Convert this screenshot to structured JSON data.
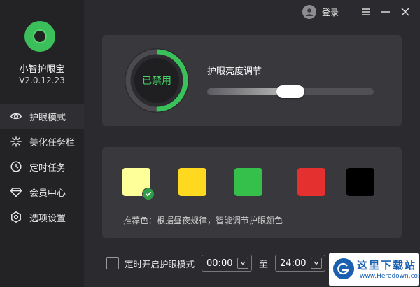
{
  "app": {
    "name": "小智护眼宝",
    "version": "V2.0.12.23"
  },
  "topbar": {
    "login_label": "登录"
  },
  "sidebar": {
    "items": [
      {
        "label": "护眼模式",
        "icon": "eye-icon",
        "active": true
      },
      {
        "label": "美化任务栏",
        "icon": "sparkle-icon",
        "active": false
      },
      {
        "label": "定时任务",
        "icon": "clock-icon",
        "active": false
      },
      {
        "label": "会员中心",
        "icon": "diamond-icon",
        "active": false
      },
      {
        "label": "选项设置",
        "icon": "settings-icon",
        "active": false
      }
    ]
  },
  "eye_mode": {
    "status": "已禁用",
    "status_ring_progress": 0.5,
    "brightness_label": "护眼亮度调节",
    "brightness_value": 0.5
  },
  "colors": {
    "swatches": [
      {
        "color": "#ffff99",
        "selected": true
      },
      {
        "color": "#ffd91f",
        "selected": false
      },
      {
        "color": "#34c04b",
        "selected": false
      },
      {
        "color": "#e53030",
        "selected": false
      },
      {
        "color": "#000000",
        "selected": false
      }
    ],
    "recommend_text": "推荐色：根据昼夜规律，智能调节护眼颜色"
  },
  "timer": {
    "checkbox_label": "定时开启护眼模式",
    "checked": false,
    "start": "00:00",
    "separator": "至",
    "end": "24:00"
  },
  "watermark": {
    "title": "这里下载站",
    "url": "www.Heredown.com"
  },
  "theme": {
    "accent": "#3ac25a",
    "background": "#2b2b2f",
    "sidebar": "#232326",
    "card": "#39393d"
  }
}
